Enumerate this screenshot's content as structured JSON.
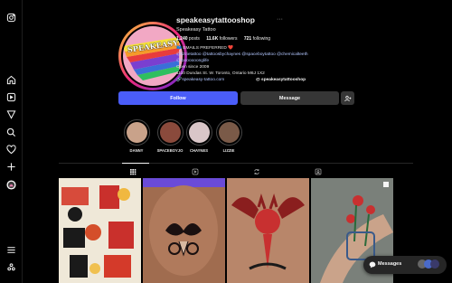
{
  "sidebar": {
    "icons": [
      "instagram-icon",
      "home-icon",
      "reels-icon",
      "explore-icon",
      "search-icon",
      "heart-icon",
      "create-icon",
      "profile-icon",
      "menu-icon",
      "threads-icon"
    ]
  },
  "profile": {
    "username": "speakeasytattooshop",
    "display_name": "Speakeasy Tattoo",
    "stats": {
      "posts_count": "1,240",
      "posts_label": "posts",
      "followers_count": "11.6K",
      "followers_label": "followers",
      "following_count": "721",
      "following_label": "following"
    },
    "avatar_text": "SPEAKEASY",
    "bio": {
      "line1": "📫 EMAILS PREFERRED ❤️",
      "line2": "@lizzietattoo @tattoosbychaynes @spaceboytattoo @chemicalteeth",
      "line3": "@looooooonglife",
      "line4": "Open since 2009",
      "line5": "1110 Dundas St. W. Toronto, Ontario M6J 1X2",
      "link1": "speakeasy-tattoo.com",
      "link2": "speakeasytattooshop"
    }
  },
  "actions": {
    "follow_label": "Follow",
    "message_label": "Message"
  },
  "highlights": [
    {
      "label": "DANNY",
      "color": "#c9a28a"
    },
    {
      "label": "SPACEBOYJO",
      "color": "#8a4a3c"
    },
    {
      "label": "CHAYNES",
      "color": "#d9c6c8"
    },
    {
      "label": "LIZZIE",
      "color": "#7a5a48"
    }
  ],
  "tabs": [
    "posts-tab",
    "reels-tab",
    "reposts-tab",
    "tagged-tab"
  ],
  "posts": [
    {
      "name": "post-flash-sheet",
      "color": "#ece5d6"
    },
    {
      "name": "post-mustache-tattoo",
      "color": "#9a6a4e"
    },
    {
      "name": "post-devil-tattoo",
      "color": "#b48266"
    },
    {
      "name": "post-flower-tattoo",
      "color": "#8a8f8a"
    }
  ],
  "messages": {
    "label": "Messages"
  },
  "colors": {
    "background": "#000000",
    "follow_button": "#4a5df9",
    "secondary_button": "#363636",
    "link": "#b3c7ff"
  }
}
